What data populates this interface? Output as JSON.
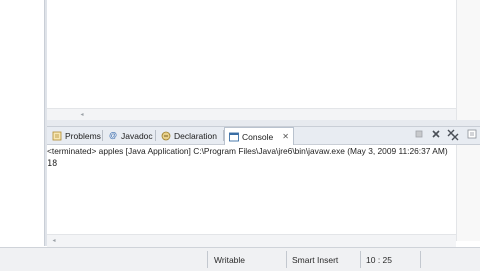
{
  "views": {
    "tabs": [
      {
        "label": "Problems",
        "icon": "problems-icon",
        "active": false
      },
      {
        "label": "Javadoc",
        "icon": "javadoc-icon",
        "active": false
      },
      {
        "label": "Declaration",
        "icon": "declaration-icon",
        "active": false
      },
      {
        "label": "Console",
        "icon": "console-icon",
        "active": true
      }
    ],
    "close_glyph": "✕",
    "toolbar_icons": [
      "terminate-icon",
      "remove-launch-icon",
      "remove-all-terminated-icon",
      "clear-console-icon"
    ]
  },
  "console": {
    "header": "<terminated> apples [Java Application] C:\\Program Files\\Java\\jre6\\bin\\javaw.exe (May 3, 2009 11:26:37 AM)",
    "output": "18"
  },
  "statusbar": {
    "mode": "Writable",
    "insert_mode": "Smart Insert",
    "position": "10 : 25"
  },
  "colors": {
    "tabbar_bg": "#e8ecf2",
    "status_bg": "#f0f1f3",
    "console_icon": "#3a6ea5"
  }
}
